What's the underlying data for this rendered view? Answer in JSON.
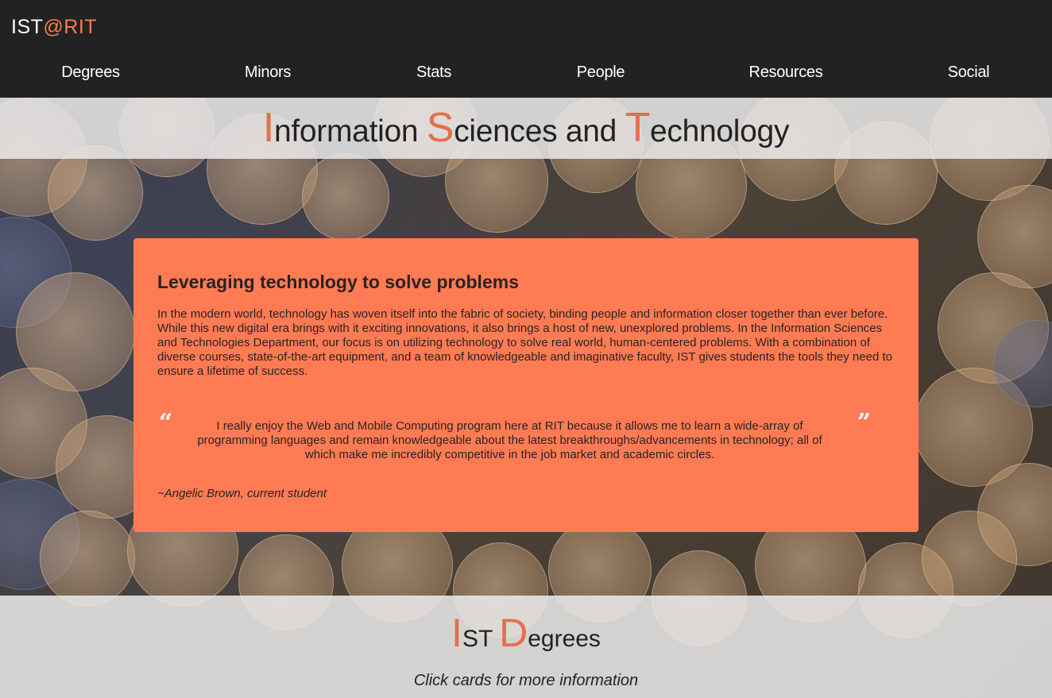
{
  "brand": {
    "prefix": "IST",
    "accent": "@RIT"
  },
  "nav": {
    "items": [
      "Degrees",
      "Minors",
      "Stats",
      "People",
      "Resources",
      "Social"
    ]
  },
  "title": {
    "word1_cap": "I",
    "word1_rest": "nformation",
    "word2_cap": "S",
    "word2_rest": "ciences and",
    "word3_cap": "T",
    "word3_rest": "echnology"
  },
  "card": {
    "heading": "Leveraging technology to solve problems",
    "body": "In the modern world, technology has woven itself into the fabric of society, binding people and information closer together than ever before. While this new digital era brings with it exciting innovations, it also brings a host of new, unexplored problems. In the Information Sciences and Technologies Department, our focus is on utilizing technology to solve real world, human-centered problems. With a combination of diverse courses, state-of-the-art equipment, and a team of knowledgeable and imaginative faculty, IST gives students the tools they need to ensure a lifetime of success.",
    "quote_open": "“",
    "quote_close": "”",
    "quote": "I really enjoy the Web and Mobile Computing program here at RIT because it allows me to learn a wide-array of programming languages and remain knowledgeable about the latest breakthroughs/advancements in technology; all of which make me incredibly competitive in the job market and academic circles.",
    "attribution": "~Angelic Brown, current student"
  },
  "degrees": {
    "cap1": "I",
    "rest1": "ST",
    "cap2": "D",
    "rest2": "egrees",
    "subtitle": "Click cards for more information"
  },
  "colors": {
    "accent": "#ff7b54",
    "header_bg": "#222222",
    "title_cap": "#e66e4c"
  }
}
